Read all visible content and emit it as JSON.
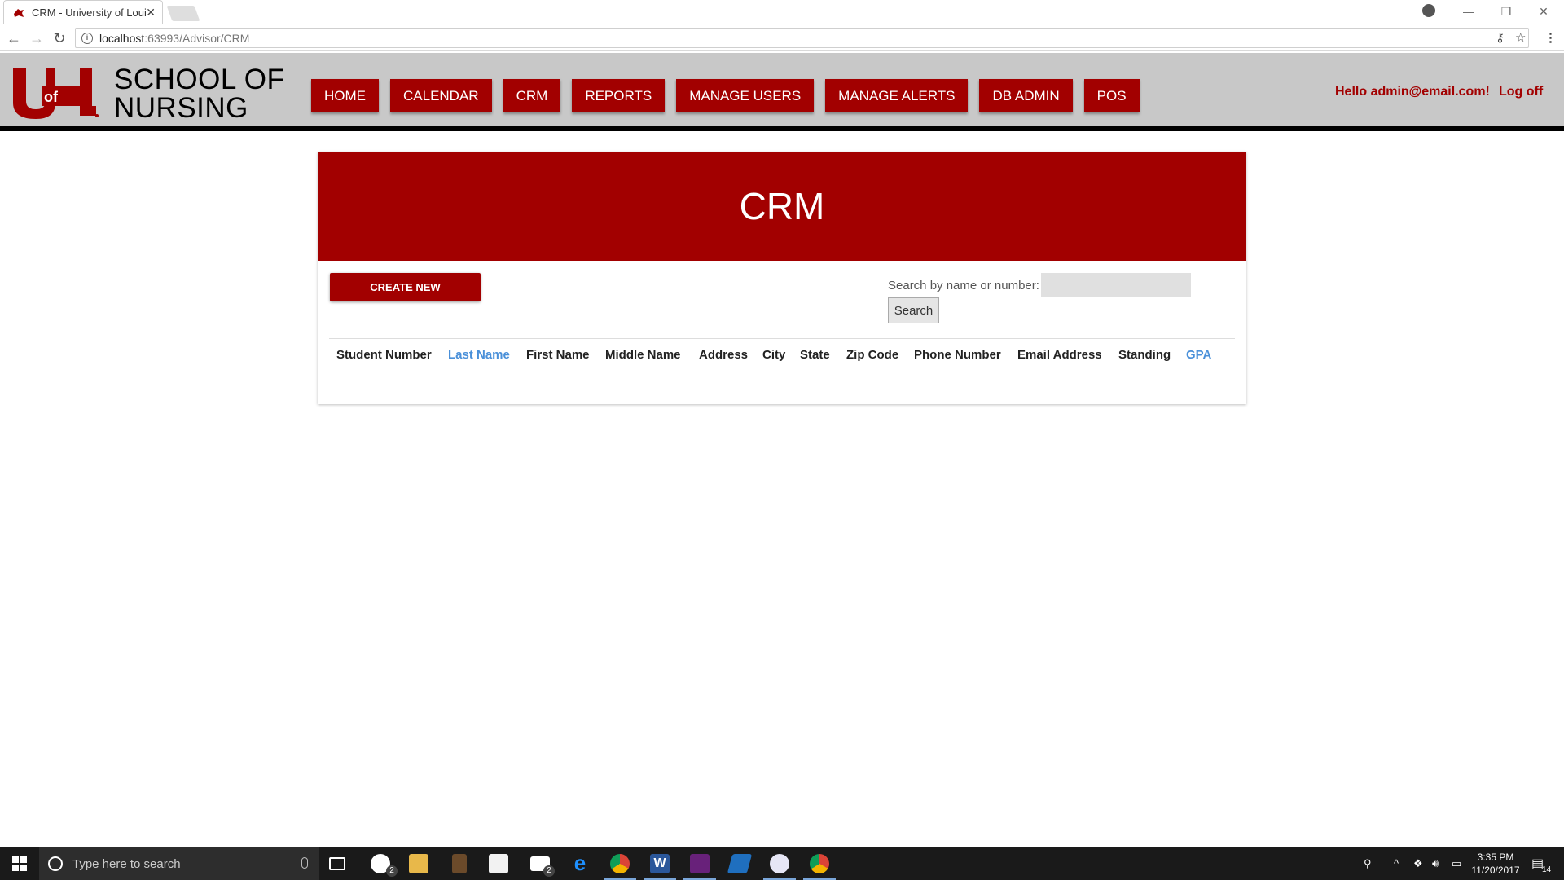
{
  "browser": {
    "tab_title": "CRM - University of Loui",
    "url_host": "localhost",
    "url_rest": ":63993/Advisor/CRM"
  },
  "site": {
    "school_name_line1": "SCHOOL OF",
    "school_name_line2": "NURSING",
    "logo_text": "UofL",
    "nav": [
      "HOME",
      "CALENDAR",
      "CRM",
      "REPORTS",
      "MANAGE USERS",
      "MANAGE ALERTS",
      "DB ADMIN",
      "POS"
    ],
    "greeting": "Hello admin@email.com!",
    "logoff": "Log off"
  },
  "page": {
    "title": "CRM",
    "create_button": "CREATE NEW",
    "search_label": "Search by name or number:",
    "search_value": "",
    "search_button": "Search",
    "columns": [
      {
        "label": "Student Number",
        "link": false
      },
      {
        "label": "Last Name",
        "link": true
      },
      {
        "label": "First Name",
        "link": false
      },
      {
        "label": "Middle Name",
        "link": false
      },
      {
        "label": "Address",
        "link": false
      },
      {
        "label": "City",
        "link": false
      },
      {
        "label": "State",
        "link": false
      },
      {
        "label": "Zip Code",
        "link": false
      },
      {
        "label": "Phone Number",
        "link": false
      },
      {
        "label": "Email Address",
        "link": false
      },
      {
        "label": "Standing",
        "link": false
      },
      {
        "label": "GPA",
        "link": true
      }
    ]
  },
  "taskbar": {
    "search_placeholder": "Type here to search",
    "time": "3:35 PM",
    "date": "11/20/2017",
    "notification_count": "14",
    "xbox_badge": "2",
    "mail_badge": "2"
  },
  "colors": {
    "brand_red": "#a20000",
    "header_gray": "#c8c8c8",
    "link_blue": "#4a90d9"
  }
}
